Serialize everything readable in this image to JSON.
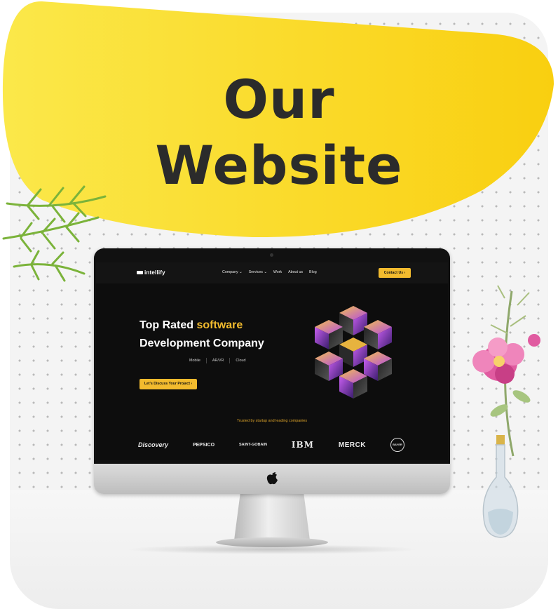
{
  "banner": {
    "line1": "Our",
    "line2": "Website",
    "color": "#f9d21e"
  },
  "website": {
    "logo": "intellify",
    "nav": {
      "items": [
        "Company",
        "Services",
        "Work",
        "About us",
        "Blog"
      ],
      "contact_label": "Contact Us"
    },
    "hero": {
      "title_part1": "Top Rated",
      "title_accent": "software",
      "title_line2": "Development Company",
      "tags": [
        "Mobile",
        "AR/VR",
        "Cloud"
      ],
      "cta_label": "Let's Discuss Your Project"
    },
    "trusted_text": "Trusted by startup and leading companies",
    "brands": [
      "Discovery",
      "PEPSICO",
      "SAINT-GOBAIN",
      "IBM",
      "MERCK",
      "BAYER"
    ],
    "accent_color": "#f2bb2e"
  },
  "icons": {
    "apple": "apple-logo-icon",
    "chevron": "chevron-right-icon",
    "dropdown": "chevron-down-icon"
  }
}
